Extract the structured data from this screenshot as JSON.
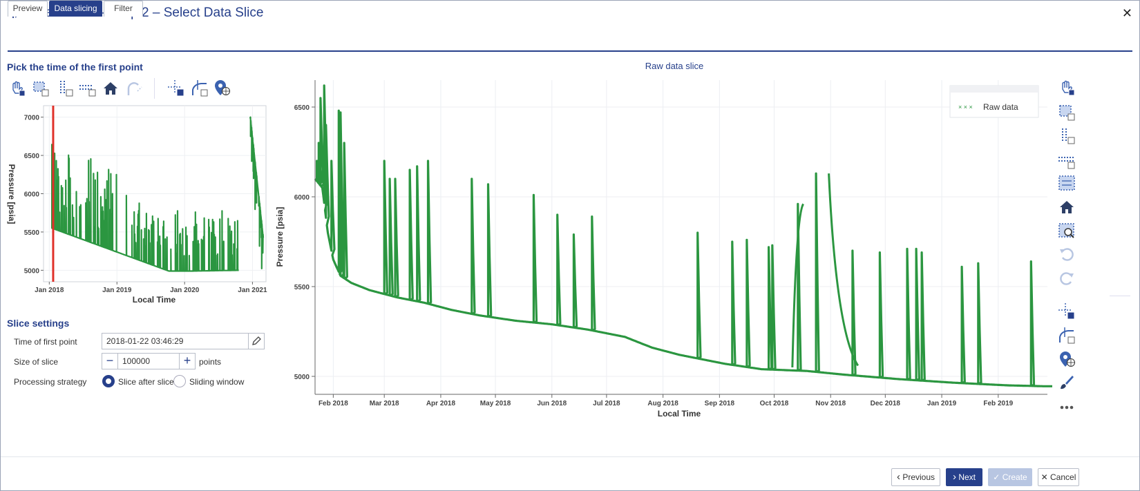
{
  "window": {
    "title": "Create Filter – Step 2 – Select Data Slice",
    "close_glyph": "✕"
  },
  "tabs": [
    {
      "label": "Preview"
    },
    {
      "label": "Data slicing"
    },
    {
      "label": "Filter"
    }
  ],
  "left_panel": {
    "title": "Pick the time of the first point",
    "toolbar": [
      "pan-icon",
      "box-zoom-icon",
      "x-zoom-icon",
      "y-zoom-icon",
      "reset-home-icon",
      "undo-disabled-icon",
      "crosshair-icon",
      "hover-icon",
      "tap-select-icon"
    ]
  },
  "overview_chart": {
    "type": "scatter",
    "xlabel": "Local Time",
    "ylabel": "Pressure [psia]",
    "x_ticks": [
      "Jan 2018",
      "Jan 2019",
      "Jan 2020",
      "Jan 2021"
    ],
    "y_ticks": [
      "5000",
      "5500",
      "6000",
      "6500",
      "7000"
    ],
    "ylim": [
      4850,
      7150
    ],
    "slice_marker_date": "2018-01-22",
    "marker_color": "#e0312a",
    "series_color": "#2b9640"
  },
  "slice_settings": {
    "title": "Slice settings",
    "time_label": "Time of first point",
    "time_value": "2018-01-22 03:46:29",
    "size_label": "Size of slice",
    "size_value": "100000",
    "minus_glyph": "−",
    "plus_glyph": "+",
    "size_unit": "points",
    "strategy_label": "Processing strategy",
    "strategy_options": [
      "Slice after slice",
      "Sliding window"
    ],
    "strategy_selected": "Slice after slice"
  },
  "chart_data": {
    "type": "scatter",
    "title": "Raw data slice",
    "xlabel": "Local Time",
    "ylabel": "Pressure [psia]",
    "x_ticks": [
      "Feb 2018",
      "Mar 2018",
      "Apr 2018",
      "May 2018",
      "Jun 2018",
      "Jul 2018",
      "Aug 2018",
      "Sep 2018",
      "Oct 2018",
      "Nov 2018",
      "Dec 2018",
      "Jan 2019",
      "Feb 2019"
    ],
    "y_ticks": [
      "5000",
      "5500",
      "6000",
      "6500"
    ],
    "ylim": [
      4900,
      6650
    ],
    "legend": {
      "entry": "Raw data",
      "marker": "× × ×",
      "placement": "top-right"
    },
    "series_color": "#2b9640",
    "grid": true
  },
  "right_toolbar": [
    "pan-icon",
    "box-zoom-icon",
    "x-zoom-icon",
    "y-zoom-icon",
    "box-select-icon",
    "reset-home-icon",
    "zoom-region-icon",
    "undo-icon",
    "redo-icon",
    "crosshair-icon",
    "hover-icon",
    "tap-select-icon",
    "brush-icon",
    "more-icon"
  ],
  "footer": {
    "previous": "Previous",
    "previous_glyph": "‹",
    "next": "Next",
    "next_glyph": "›",
    "create": "Create",
    "create_glyph": "✓",
    "cancel": "Cancel",
    "cancel_glyph": "✕"
  }
}
